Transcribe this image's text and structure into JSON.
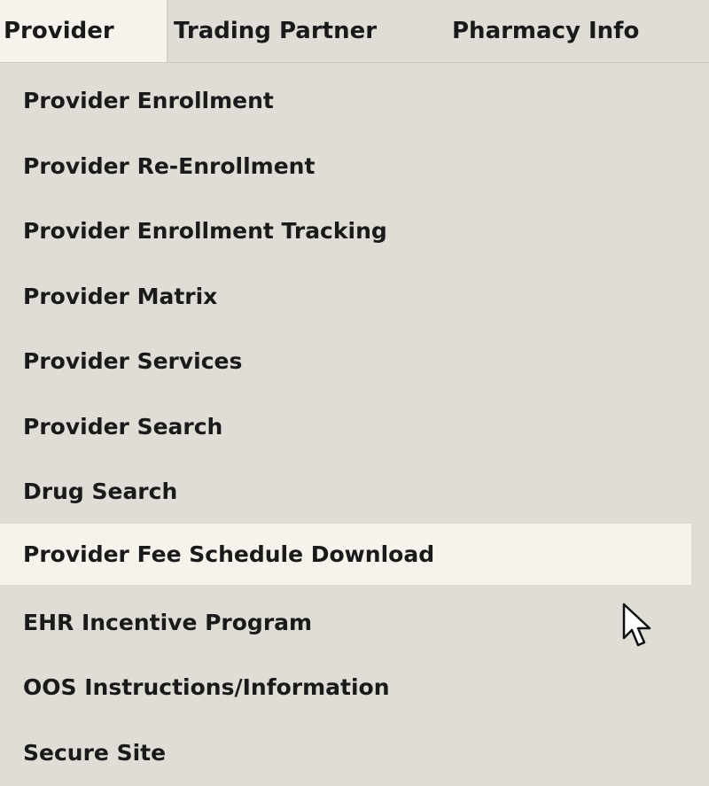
{
  "menubar": {
    "tabs": [
      {
        "label": "Provider",
        "active": true
      },
      {
        "label": "Trading Partner",
        "active": false
      },
      {
        "label": "Pharmacy Info",
        "active": false
      }
    ]
  },
  "menu": {
    "items": [
      {
        "label": "Provider Enrollment"
      },
      {
        "label": "Provider Re-Enrollment"
      },
      {
        "label": "Provider Enrollment Tracking"
      },
      {
        "label": "Provider Matrix"
      },
      {
        "label": "Provider Services"
      },
      {
        "label": "Provider Search"
      },
      {
        "label": "Drug Search"
      },
      {
        "label": "Provider Fee Schedule Download",
        "hovered": true
      },
      {
        "label": "EHR Incentive Program"
      },
      {
        "label": "OOS Instructions/Information"
      },
      {
        "label": "Secure Site"
      }
    ]
  },
  "colors": {
    "background": "#e0ddd6",
    "highlight": "#f6f3ec",
    "text": "#1a1a1a"
  },
  "icons": {
    "pointer": "mouse-pointer-icon"
  }
}
